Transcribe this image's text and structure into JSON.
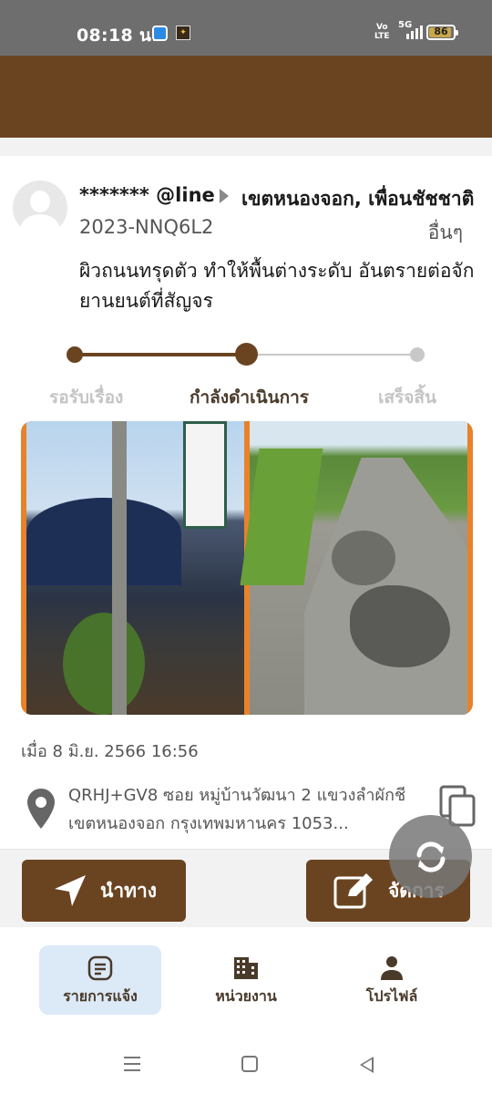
{
  "status_bar": {
    "time": "08:18 น.",
    "battery": "86",
    "network": "5G",
    "volte": "Vo LTE"
  },
  "report": {
    "reporter": "******* @line",
    "district": "เขตหนองจอก, เพื่อนชัชชาติ",
    "case_id": "2023-NNQ6L2",
    "category": "อื่นๆ",
    "description": "ผิวถนนทรุดตัว ทำให้พื้นต่างระดับ อันตรายต่อจักยานยนต์ที่สัญจร",
    "steps": [
      "รอรับเรื่อง",
      "กำลังดำเนินการ",
      "เสร็จสิ้น"
    ],
    "current_step_index": 1,
    "date": "เมื่อ 8 มิ.ย. 2566 16:56",
    "address": "QRHJ+GV8 ซอย หมู่บ้านวัฒนา 2 แขวงลำผักชี เขตหนองจอก กรุงเทพมหานคร 1053..."
  },
  "actions": {
    "navigate_label": "นำทาง",
    "manage_label": "จัดการ"
  },
  "bottom_nav": {
    "items": [
      {
        "label": "รายการแจ้ง",
        "icon": "list-icon",
        "active": true
      },
      {
        "label": "หน่วยงาน",
        "icon": "building-icon",
        "active": false
      },
      {
        "label": "โปรไฟล์",
        "icon": "person-icon",
        "active": false
      }
    ]
  },
  "colors": {
    "brand_brown": "#6a4421",
    "photo_frame": "#e8822a",
    "active_tab_bg": "#dce9f7",
    "inactive_step": "#c4c4c4"
  }
}
